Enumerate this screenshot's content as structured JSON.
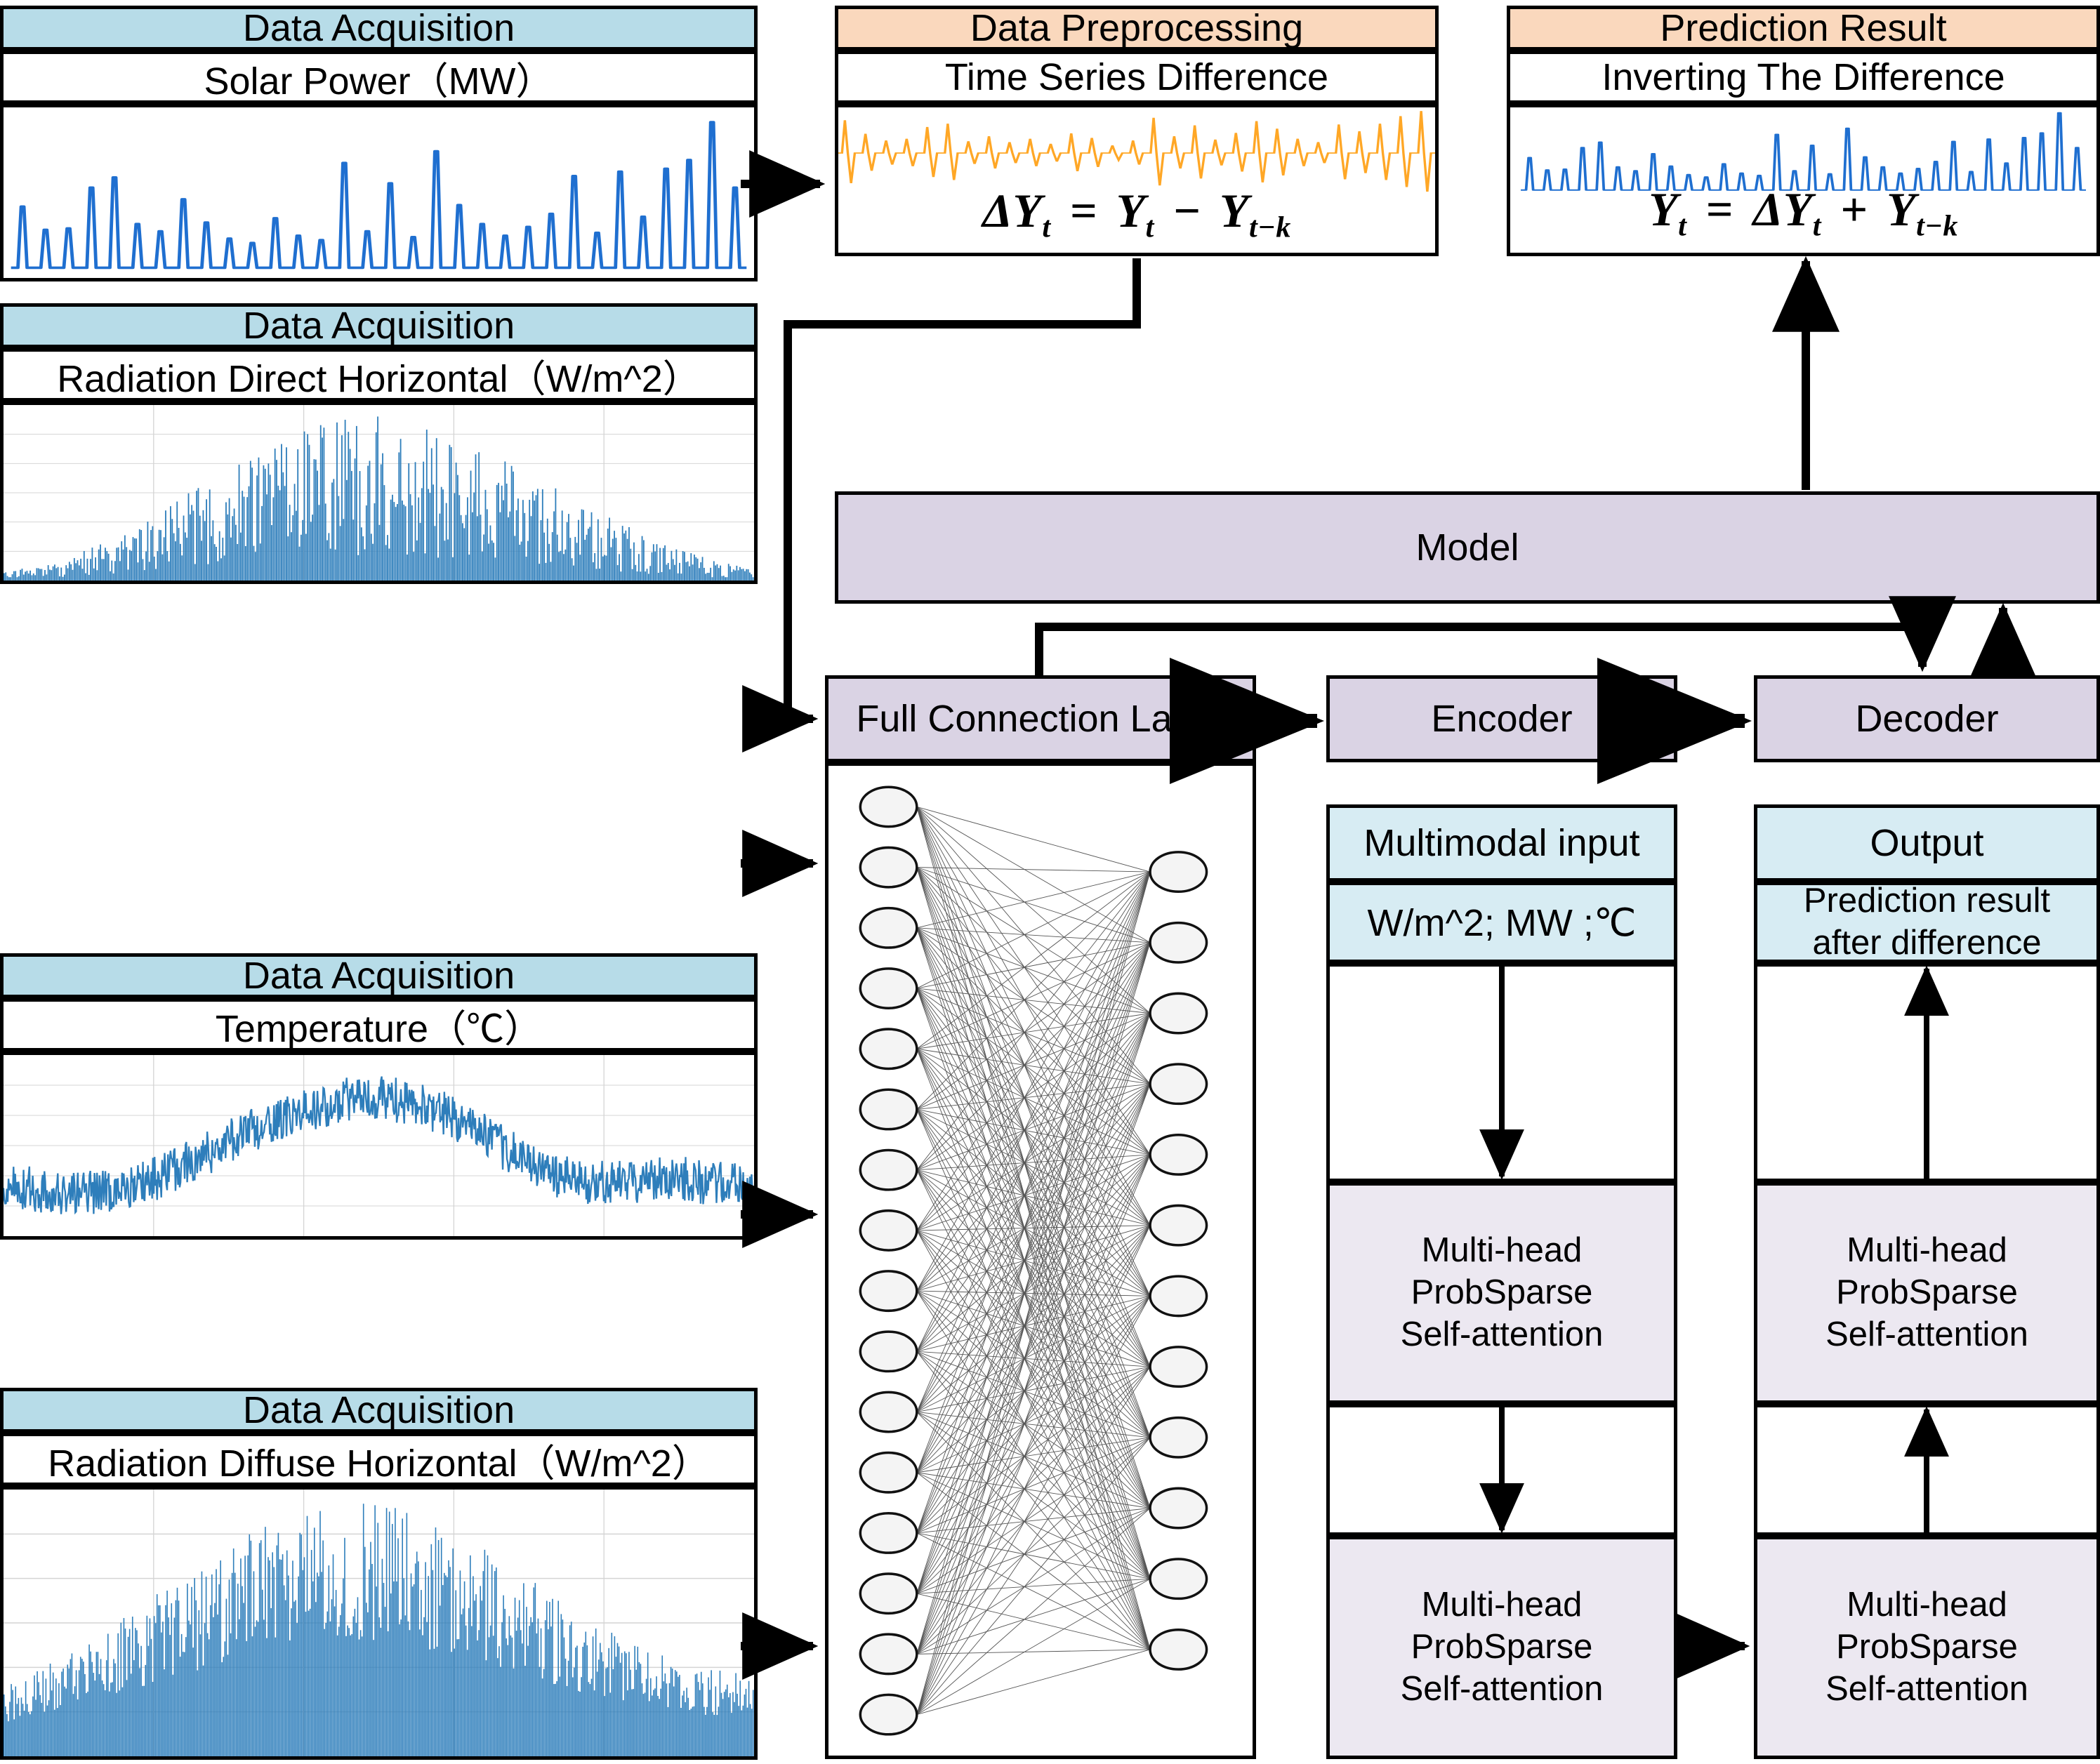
{
  "colors": {
    "header_blue": "#b7dce8",
    "header_orange": "#fad8bd",
    "block_lavender": "#dad3e4",
    "block_lavender_light": "#ece8f1",
    "subheader_lightblue": "#d7ecf3",
    "series_blue": "#1f6fd0",
    "series_bar_blue": "#2e7ebb",
    "series_orange": "#ffa726",
    "border": "#000000"
  },
  "panels": {
    "solar_power": {
      "header": "Data Acquisition",
      "subtitle": "Solar Power（MW）"
    },
    "radiation_direct": {
      "header": "Data Acquisition",
      "subtitle": "Radiation Direct Horizontal（W/m^2）"
    },
    "temperature": {
      "header": "Data Acquisition",
      "subtitle": "Temperature（℃）"
    },
    "radiation_diffuse": {
      "header": "Data Acquisition",
      "subtitle": "Radiation Diffuse Horizontal（W/m^2）"
    },
    "preprocessing": {
      "header": "Data Preprocessing",
      "subtitle": "Time Series Difference",
      "formula_parts": {
        "lhs": "ΔY",
        "lhs_sub": "t",
        "eq": "=",
        "a": "Y",
        "a_sub": "t",
        "op": "−",
        "b": "Y",
        "b_sub": "t−k"
      },
      "formula_text": "ΔYt = Yt − Yt−k"
    },
    "prediction": {
      "header": "Prediction Result",
      "subtitle": "Inverting The Difference",
      "formula_parts": {
        "lhs": "Y",
        "lhs_sub": "t",
        "eq": "=",
        "a": "ΔY",
        "a_sub": "t",
        "op": "+",
        "b": "Y",
        "b_sub": "t−k"
      },
      "formula_text": "Yt = ΔYt + Yt−k"
    }
  },
  "model": {
    "title": "Model",
    "full_connection_layer": {
      "title": "Full Connection Layer",
      "input_nodes": 16,
      "output_nodes": 12
    },
    "encoder": {
      "title": "Encoder",
      "input_label": "Multimodal input",
      "units_label": "W/m^2; MW ;℃",
      "attention_1": "Multi-head\nProbSparse\nSelf-attention",
      "attention_2": "Multi-head\nProbSparse\nSelf-attention"
    },
    "decoder": {
      "title": "Decoder",
      "output_label": "Output",
      "result_label": "Prediction result\nafter difference",
      "attention_1": "Multi-head\nProbSparse\nSelf-attention",
      "attention_2": "Multi-head\nProbSparse\nSelf-attention"
    }
  },
  "chart_data": [
    {
      "id": "solar_power_series",
      "type": "line",
      "title": "Solar Power（MW）",
      "ylabel": "MW",
      "xlabel": "",
      "grid": false,
      "color": "#1f6fd0",
      "description": "Daily solar power peaks; repeated narrow spikes rising toward the right",
      "values": [
        0.42,
        0.26,
        0.27,
        0.55,
        0.62,
        0.3,
        0.25,
        0.47,
        0.31,
        0.2,
        0.17,
        0.34,
        0.22,
        0.19,
        0.72,
        0.25,
        0.58,
        0.21,
        0.8,
        0.43,
        0.3,
        0.22,
        0.28,
        0.37,
        0.63,
        0.24,
        0.66,
        0.35,
        0.68,
        0.74,
        1.0,
        0.55
      ]
    },
    {
      "id": "radiation_direct_series",
      "type": "bar",
      "title": "Radiation Direct Horizontal（W/m^2）",
      "ylabel": "W/m^2",
      "xlabel": "",
      "grid": true,
      "color": "#2e7ebb",
      "description": "Dense daily bars forming a seasonal bell envelope peaking mid-year",
      "envelope": [
        0.05,
        0.1,
        0.18,
        0.28,
        0.42,
        0.58,
        0.72,
        0.85,
        0.95,
        1.0,
        0.97,
        0.9,
        0.82,
        0.7,
        0.58,
        0.44,
        0.3,
        0.2,
        0.12,
        0.07
      ]
    },
    {
      "id": "temperature_series",
      "type": "line",
      "title": "Temperature（℃）",
      "ylabel": "℃",
      "xlabel": "",
      "grid": true,
      "color": "#2e7ebb",
      "description": "Noisy temperature trace with seasonal hump in the middle",
      "envelope": [
        0.3,
        0.26,
        0.24,
        0.28,
        0.34,
        0.46,
        0.58,
        0.66,
        0.74,
        0.8,
        0.78,
        0.72,
        0.6,
        0.46,
        0.34,
        0.3,
        0.32,
        0.34,
        0.3,
        0.28
      ]
    },
    {
      "id": "radiation_diffuse_series",
      "type": "bar",
      "title": "Radiation Diffuse Horizontal（W/m^2）",
      "ylabel": "W/m^2",
      "xlabel": "",
      "grid": true,
      "color": "#2e7ebb",
      "description": "Dense daily bars with a broad smooth bell envelope",
      "envelope": [
        0.28,
        0.35,
        0.44,
        0.55,
        0.66,
        0.76,
        0.86,
        0.93,
        0.98,
        1.0,
        0.98,
        0.92,
        0.84,
        0.74,
        0.62,
        0.52,
        0.44,
        0.38,
        0.34,
        0.32
      ]
    },
    {
      "id": "difference_series",
      "type": "line",
      "title": "Time Series Difference",
      "ylabel": "ΔY",
      "xlabel": "",
      "grid": false,
      "color": "#ffa726",
      "description": "Differenced signal oscillating symmetrically about zero",
      "values": [
        0.78,
        0.46,
        0.3,
        0.34,
        0.62,
        0.7,
        0.28,
        0.4,
        0.26,
        0.34,
        0.22,
        0.47,
        0.36,
        0.18,
        0.3,
        0.84,
        0.4,
        0.66,
        0.32,
        0.48,
        0.76,
        0.58,
        0.34,
        0.26,
        0.68,
        0.52,
        0.7,
        0.88,
        1.0
      ]
    },
    {
      "id": "prediction_series",
      "type": "line",
      "title": "Inverting The Difference",
      "ylabel": "MW",
      "xlabel": "",
      "grid": false,
      "color": "#1f6fd0",
      "description": "Reconstructed solar power peaks after inverting the difference",
      "values": [
        0.42,
        0.26,
        0.27,
        0.55,
        0.62,
        0.3,
        0.25,
        0.47,
        0.31,
        0.2,
        0.17,
        0.34,
        0.22,
        0.19,
        0.72,
        0.25,
        0.58,
        0.21,
        0.8,
        0.43,
        0.3,
        0.22,
        0.28,
        0.37,
        0.63,
        0.24,
        0.66,
        0.35,
        0.68,
        0.74,
        1.0,
        0.55
      ]
    }
  ]
}
